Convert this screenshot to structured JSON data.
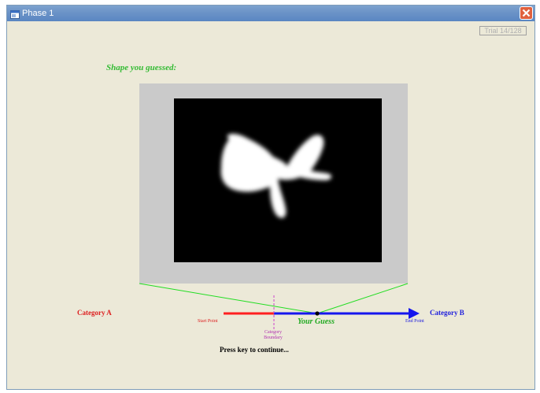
{
  "window": {
    "title": "Phase 1",
    "icons": {
      "app": "window-app-icon",
      "close": "close-x-icon"
    }
  },
  "trial": {
    "text": "Trial   14/128"
  },
  "stimulus": {
    "heading": "Shape you guessed:",
    "shape": "white-blob-shape",
    "colors": {
      "frame": "#cacaca",
      "panel": "#000000",
      "shape": "#ffffff"
    }
  },
  "scale": {
    "category_a": "Category A",
    "category_b": "Category B",
    "start_point": "Start Point",
    "end_point": "End Point",
    "category_boundary": "Category Boundary",
    "your_guess": "Your Guess",
    "colors": {
      "start_segment": "#ff2020",
      "end_segment": "#2020ff",
      "boundary": "#cc44cc",
      "guide_lines": "#22dd22"
    }
  },
  "instructions": {
    "press_key": "Press key to continue..."
  }
}
